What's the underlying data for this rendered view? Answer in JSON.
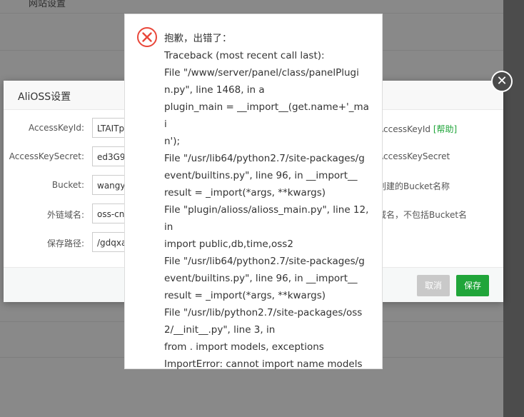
{
  "background": {
    "top_title": "网站设置"
  },
  "oss_dialog": {
    "title": "AliOSS设置",
    "fields": [
      {
        "label": "AccessKeyId:",
        "value": "LTAITp",
        "hint": "AccessKeyId",
        "help": "[帮助]"
      },
      {
        "label": "AccessKeySecret:",
        "value": "ed3G9",
        "hint": "AccessKeySecret",
        "help": ""
      },
      {
        "label": "Bucket:",
        "value": "wangy",
        "hint": "创建的Bucket名称",
        "help": ""
      },
      {
        "label": "外链域名:",
        "value": "oss-cn",
        "hint": "域名，不包括Bucket名",
        "help": ""
      },
      {
        "label": "保存路径:",
        "value": "/gdqxa",
        "hint": "",
        "help": ""
      }
    ],
    "cancel_label": "取消",
    "save_label": "保存",
    "close_glyph": "✕"
  },
  "error_dialog": {
    "lines": [
      "抱歉，出错了：",
      "Traceback (most recent call last):",
      "File \"/www/server/panel/class/panelPlugi",
      "n.py\", line 1468, in a",
      "plugin_main = __import__(get.name+'_mai",
      "n');",
      "File \"/usr/lib64/python2.7/site-packages/g",
      "event/builtins.py\", line 96, in __import__",
      "result = _import(*args, **kwargs)",
      "File \"plugin/alioss/alioss_main.py\", line 12,",
      "in",
      "import public,db,time,oss2",
      "File \"/usr/lib64/python2.7/site-packages/g",
      "event/builtins.py\", line 96, in __import__",
      "result = _import(*args, **kwargs)",
      "File \"/usr/lib/python2.7/site-packages/oss",
      "2/__init__.py\", line 3, in",
      "from . import models, exceptions",
      "ImportError: cannot import name models"
    ],
    "icon": "error-circle-x",
    "icon_color": "#e9473a"
  },
  "colors": {
    "accent_green": "#20a53a",
    "overlay": "rgba(0,0,0,0.45)"
  }
}
